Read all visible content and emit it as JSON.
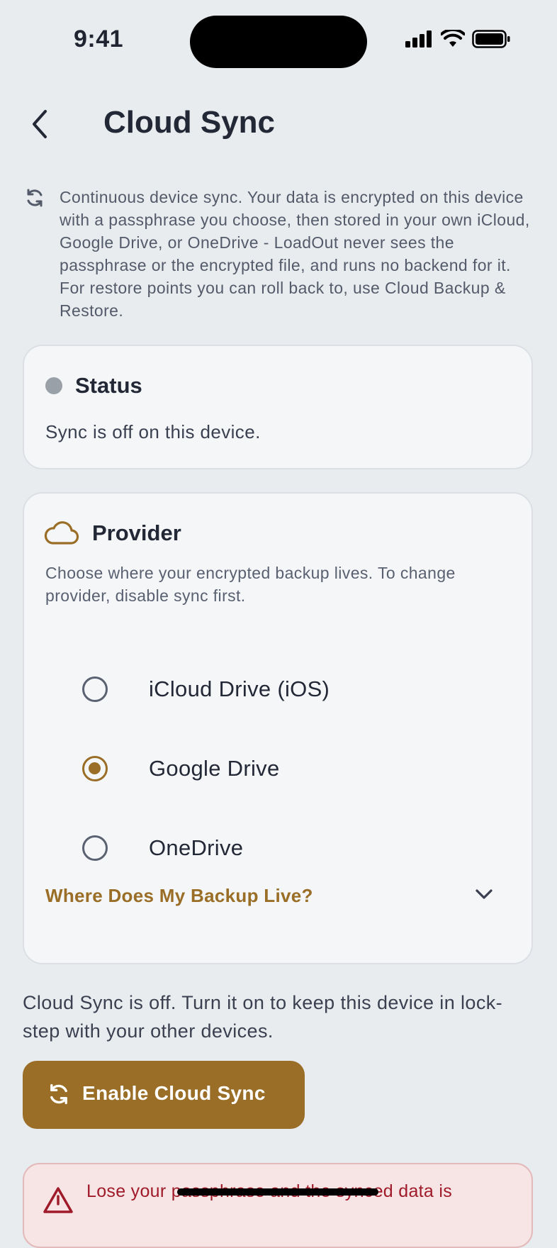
{
  "status_bar": {
    "time": "9:41",
    "icons": [
      "cellular-signal-icon",
      "wifi-icon",
      "battery-icon"
    ]
  },
  "header": {
    "back_icon": "chevron-left-icon",
    "title": "Cloud Sync"
  },
  "intro": {
    "icon": "sync-icon",
    "text": "Continuous device sync. Your data is encrypted on this device with a passphrase you choose, then stored in your own iCloud, Google Drive, or OneDrive - LoadOut never sees the passphrase or the encrypted file, and runs no backend for it. For restore points you can roll back to, use Cloud Backup & Restore."
  },
  "status_card": {
    "title": "Status",
    "text": "Sync is off on this device."
  },
  "provider_card": {
    "icon": "cloud-icon",
    "title": "Provider",
    "description": "Choose where your encrypted backup lives. To change provider, disable sync first.",
    "options": [
      {
        "label": "iCloud Drive (iOS)",
        "selected": false
      },
      {
        "label": "Google Drive",
        "selected": true
      },
      {
        "label": "OneDrive",
        "selected": false
      }
    ],
    "expander_label": "Where Does My Backup Live?"
  },
  "sync_off_text": "Cloud Sync is off. Turn it on to keep this device in lock-step with your other devices.",
  "enable_button": {
    "label": "Enable Cloud Sync",
    "icon": "sync-icon"
  },
  "warning": {
    "icon": "warning-triangle-icon",
    "text": "Lose your passphrase and the synced data is"
  },
  "colors": {
    "accent": "#9A6E26",
    "background": "#E9ECEF",
    "card": "#F4F6F8",
    "warning_text": "#A01B2A"
  }
}
